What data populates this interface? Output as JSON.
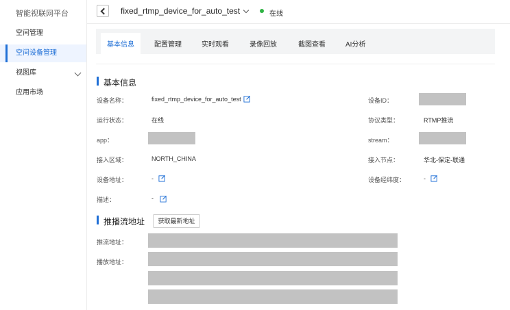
{
  "sidebar": {
    "title": "智能视联网平台",
    "items": [
      {
        "label": "空间管理"
      },
      {
        "label": "空间设备管理"
      },
      {
        "label": "视图库"
      },
      {
        "label": "应用市场"
      }
    ]
  },
  "header": {
    "device_name": "fixed_rtmp_device_for_auto_test",
    "status": "在线",
    "status_color": "#2fb344"
  },
  "tabs": [
    "基本信息",
    "配置管理",
    "实时观看",
    "录像回放",
    "截图查看",
    "AI分析"
  ],
  "basic_info": {
    "section_title": "基本信息",
    "device_name_label": "设备名称：",
    "device_name_value": "fixed_rtmp_device_for_auto_test",
    "device_id_label": "设备ID：",
    "run_status_label": "运行状态：",
    "run_status_value": "在线",
    "protocol_label": "协议类型：",
    "protocol_value": "RTMP推流",
    "app_label": "app：",
    "stream_label": "stream：",
    "region_label": "接入区域：",
    "region_value": "NORTH_CHINA",
    "node_label": "接入节点：",
    "node_value": "华北-保定-联通",
    "address_label": "设备地址：",
    "address_value": "-",
    "latlng_label": "设备经纬度：",
    "latlng_value": "-",
    "desc_label": "描述：",
    "desc_value": "-"
  },
  "push_stream": {
    "section_title": "推播流地址",
    "fetch_button": "获取最新地址",
    "push_label": "推流地址：",
    "play_label": "播放地址："
  },
  "colors": {
    "accent": "#1f6fd6",
    "redacted": "#c2c2c2"
  }
}
